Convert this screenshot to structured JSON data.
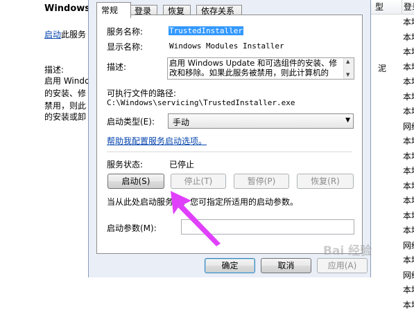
{
  "background": {
    "window_title": "Windows",
    "link_text": "启动",
    "link_suffix": "此服务",
    "desc_label": "描述:",
    "desc_lines": [
      "启用 Windo",
      "的安装、修",
      "禁用，则此",
      "的安装或卸"
    ],
    "right_col_header_1": "型",
    "right_col_header_2": "登录",
    "fragment": "泥",
    "logon_values": [
      "本地",
      "本地",
      "本地",
      "本地",
      "本地",
      "本地",
      "本地",
      "网络",
      "本地",
      "本地",
      "本地",
      "本地",
      "本地",
      "本地",
      "本地",
      "网络",
      "本地",
      "网络",
      "本地",
      "本地"
    ]
  },
  "dialog": {
    "tabs": [
      "常规",
      "登录",
      "恢复",
      "依存关系"
    ],
    "service_name_label": "服务名称:",
    "service_name_value": "TrustedInstaller",
    "display_name_label": "显示名称:",
    "display_name_value": "Windows Modules Installer",
    "description_label": "描述:",
    "description_value": "启用 Windows Update 和可选组件的安装、修改和移除。如果此服务被禁用，则此计算机的",
    "exe_path_label": "可执行文件的路径:",
    "exe_path_value": "C:\\Windows\\servicing\\TrustedInstaller.exe",
    "startup_type_label": "启动类型(E):",
    "startup_type_value": "手动",
    "help_link": "帮助我配置服务启动选项。",
    "status_label": "服务状态:",
    "status_value": "已停止",
    "buttons": {
      "start": "启动(S)",
      "stop": "停止(T)",
      "pause": "暂停(P)",
      "resume": "恢复(R)"
    },
    "hint_text": "当从此处启动服务时，您可指定所适用的启动参数。",
    "start_params_label": "启动参数(M):",
    "start_params_value": "",
    "ok": "确定",
    "cancel": "取消",
    "apply": "应用(A)"
  },
  "watermark": "Bai 经验",
  "colors": {
    "arrow": "#e040fb",
    "selection": "#3399ff",
    "link": "#0645ad",
    "dialog_frame": "#e9eef7"
  }
}
